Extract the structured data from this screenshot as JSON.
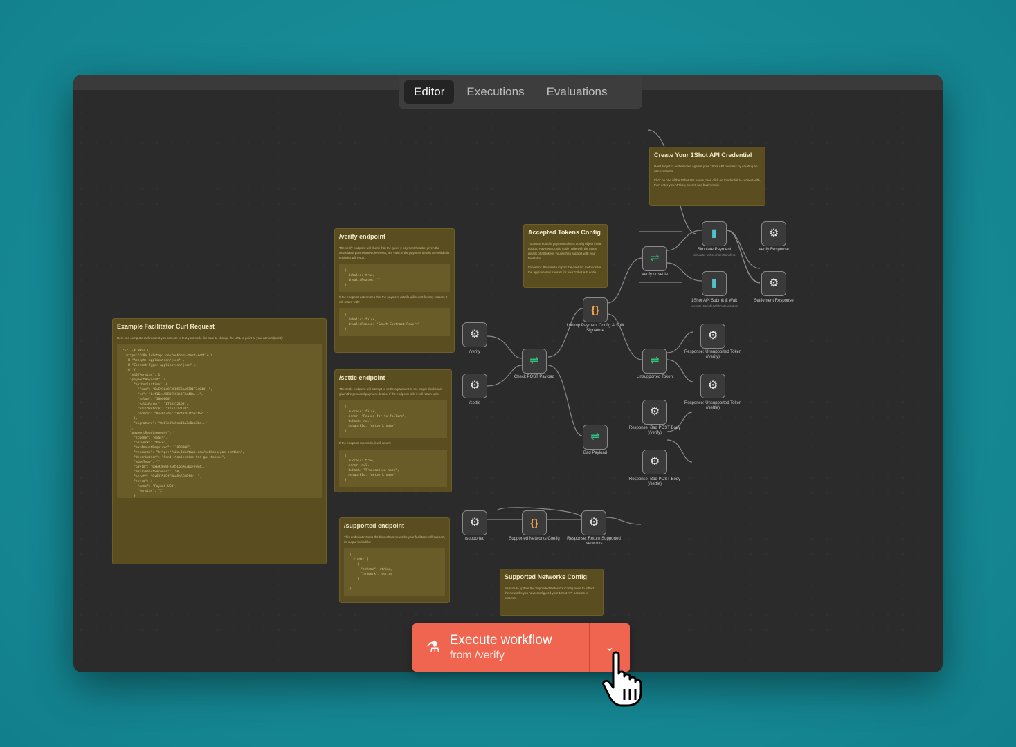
{
  "tabs": [
    "Editor",
    "Executions",
    "Evaluations"
  ],
  "notes": {
    "credential": {
      "title": "Create Your 1Shot API Credential",
      "text1": "Don't forget to authenticate against your 1Shot API business by creating an n8n credential.",
      "text2": "Click on one of the 1Shot API nodes, then click on Credential to connect with, then enter you API key, secret, and business id."
    },
    "tokens": {
      "title": "Accepted Tokens Config",
      "text1": "You must edit the payment tokens config object in the Lookup Payment Config code node with the token details of all tokens you wish to support with your facilitator.",
      "text2": "Important: Be sure to import the contract methods for the approve and transfer for your 1Shot API node."
    },
    "verify": {
      "title": "/verify endpoint",
      "text1": "The verify endpoint will check that the given x-payment header, given the associated paymentRequirements, are valid. If the payment details are valid this endpoint will return:",
      "code1": "{\n  isValid: true,\n  invalidReason: \"\"\n}",
      "text2": "If the endpoint determines that the payment details will revert for any reason, it will return with:",
      "code2": "{\n  isValid: false,\n  invalidReason: \"Smart Contract Revert\"\n}"
    },
    "settle": {
      "title": "/settle endpoint",
      "text1": "The settle endpoint will attempt to settle a payment to the target blockchain given the provided payment details. If the endpoint fails it will return with:",
      "code1": "{\n  success: false,\n  error: \"Reason for tx failure\",\n  txHash: null,\n  networkId: \"network name\"\n}",
      "text2": "If the endpoint succeeds, it will return:",
      "code2": "{\n  success: true,\n  error: null,\n  txHash: \"Transaction hash\",\n  networkId: \"network name\"\n}"
    },
    "curl": {
      "title": "Example Facilitator Curl Request",
      "text1": "Here is a complete curl request you can use to test your node (be sure to change the URL to point at your n8n endpoint):",
      "code1": "curl -X POST \\\n  https://n8n.1shotapi.dev/webhook-test/settle \\\n  -H \"Accept: application/json\" \\\n  -H \"Content-Type: application/json\" \\\n  -d '{\n    \"x402Version\": 1,\n    \"paymentPayload\": {\n      \"authorization\": {\n        \"from\": \"0xE936e8FAEB5C6bA63D1F7e04d..\",\n        \"to\": \"0xf16e4A5B0E5C1e2F3d40a...\",\n        \"value\": \"1000000\",\n        \"validAfter\": \"1753312168\",\n        \"validBefore\": \"1753312168\",\n        \"nonce\": \"0x4bf7d5c7f0748207fb31f9c..\"\n      },\n      \"signature\": \"0x67e02a9cc13a3e0ca1bd..\"\n    },\n    \"paymentRequirements\": {\n      \"scheme\": \"exact\",\n      \"network\": \"base\",\n      \"maxAmountRequired\": \"1000000\",\n      \"resource\": \"https://n8n.1shotapi.dev/webhook/gas-station\",\n      \"description\": \"Send stablecoins for gas tokens\",\n      \"mimeType\": \"\",\n      \"payTo\": \"0xE936e8FAEB5C6bA63D1F7e04..\",\n      \"maxTimeoutSeconds\": 150,\n      \"asset\": \"0x833589fCD6eDb6E08f4c..\",\n      \"extra\": {\n        \"name\": \"Paymnt USD\",\n        \"version\": \"2\"\n      }\n    }\n  }'"
    },
    "supported": {
      "title": "/supported endpoint",
      "text1": "This endpoint returns the blockchain networks your facilitator will support, its output looks like:",
      "code1": "{\n  kinds: [\n    {\n      \"scheme\": string,\n      \"network\": string\n    }\n  ]\n}"
    },
    "networks": {
      "title": "Supported Networks Config",
      "text1": "Be sure to update the Supported Networks Config node to reflect the networks you have configured your 1Shot API account to process."
    }
  },
  "nodes": {
    "verify": "/verify",
    "settle": "/settle",
    "check": "Check POST Payload",
    "lookup": "Lookup Payment Config & Split Signature",
    "verifyOrSettle": "Verify or settle",
    "simulate": "Simulate Payment",
    "simulateSub": "simulate: 1shot.chainTransfers",
    "verifyResponse": "Verify Response",
    "submit": "1Shot API Submit & Wait",
    "submitSub": "execute: transferWithAuthorization",
    "settlement": "Settlement Response",
    "unsupported": "Unsupported Token",
    "unsupVerify": "Response: Unsupported Token (/verify)",
    "unsupSettle": "Response: Unsupported Token (/settle)",
    "bad": "Bad Payload",
    "badVerify": "Response: Bad POST Body (/verify)",
    "badSettle": "Response: Bad POST Body (/settle)",
    "supported": "/supported",
    "networksNode": "Supported Networks Config",
    "returnSupported": "Response: Return Supported Networks"
  },
  "execute": {
    "title": "Execute workflow",
    "subtitle": "from /verify"
  },
  "icons": {
    "webhook": "webhook-icon",
    "code": "code-icon",
    "switch": "switch-icon",
    "oneshot": "oneshot-icon",
    "flask": "flask-icon",
    "chevron": "chevron-down-icon",
    "cursor": "hand-pointer-icon"
  }
}
